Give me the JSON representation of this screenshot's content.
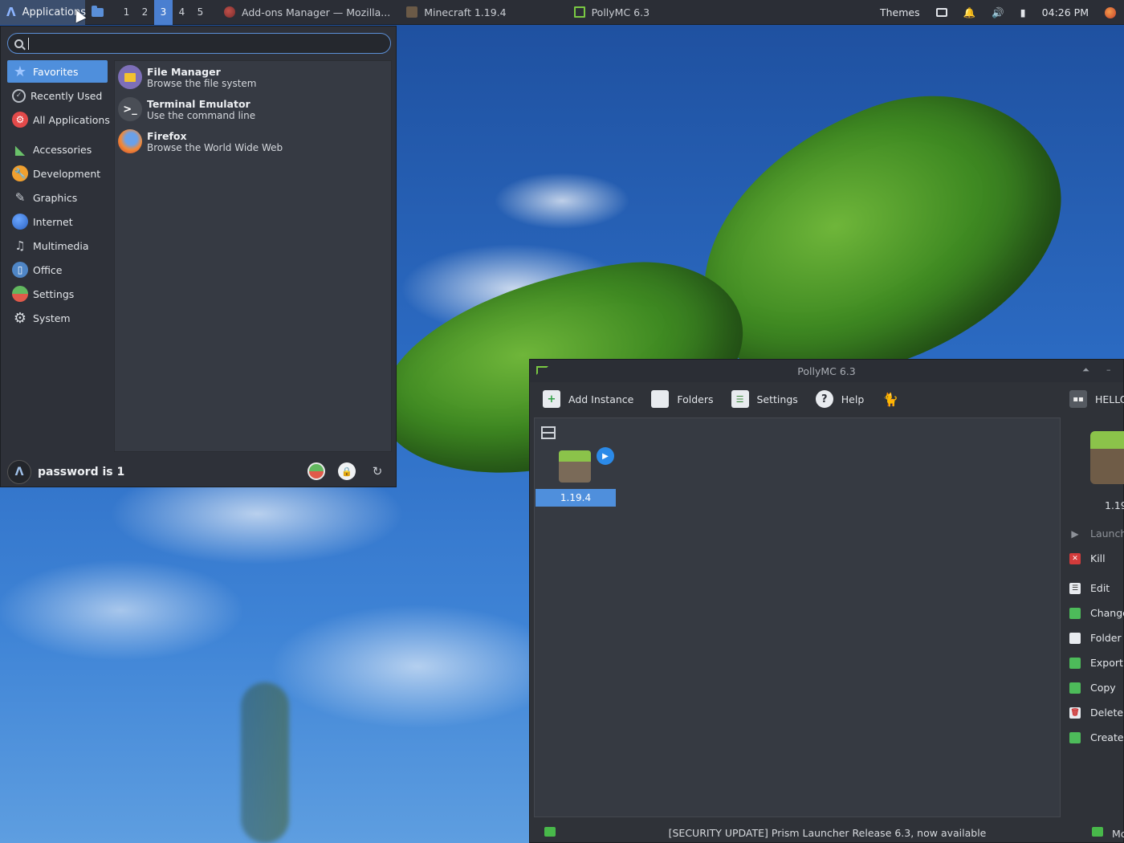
{
  "panel": {
    "applications_label": "Applications",
    "workspaces": [
      "1",
      "2",
      "3",
      "4",
      "5"
    ],
    "active_workspace": "3",
    "tasks": [
      {
        "title": "Add-ons Manager — Mozilla...",
        "icon": "firefox-icon"
      },
      {
        "title": "Minecraft 1.19.4",
        "icon": "minecraft-icon"
      },
      {
        "title": "PollyMC 6.3",
        "icon": "pollymc-icon"
      }
    ],
    "themes_label": "Themes",
    "clock": "04:26 PM"
  },
  "menu": {
    "search_value": "",
    "categories": [
      {
        "label": "Favorites",
        "icon": "star-icon",
        "color": "#4f8fdc"
      },
      {
        "label": "Recently Used",
        "icon": "clock-icon",
        "color": "#2e3139"
      },
      {
        "label": "All Applications",
        "icon": "apps-icon",
        "color": "#e34a4a"
      },
      {
        "label": "Accessories",
        "icon": "ruler-icon",
        "color": "#6ac16a"
      },
      {
        "label": "Development",
        "icon": "wrench-icon",
        "color": "#f0a030"
      },
      {
        "label": "Graphics",
        "icon": "brush-icon",
        "color": "#8a8e96"
      },
      {
        "label": "Internet",
        "icon": "globe-icon",
        "color": "#3b7ddd"
      },
      {
        "label": "Multimedia",
        "icon": "film-icon",
        "color": "#8a8e96"
      },
      {
        "label": "Office",
        "icon": "document-icon",
        "color": "#4f86c6"
      },
      {
        "label": "Settings",
        "icon": "toggle-icon",
        "color": "#62b85f"
      },
      {
        "label": "System",
        "icon": "gear-icon",
        "color": "#9aa0a8"
      }
    ],
    "apps": [
      {
        "name": "File Manager",
        "desc": "Browse the file system",
        "icon": "folder-icon",
        "color": "#7d6fb8"
      },
      {
        "name": "Terminal Emulator",
        "desc": "Use the command line",
        "icon": "terminal-icon",
        "color": "#4a4e56"
      },
      {
        "name": "Firefox",
        "desc": "Browse the World Wide Web",
        "icon": "firefox-icon",
        "color": "#e8723a"
      }
    ],
    "user": "password is 1"
  },
  "pollymc": {
    "title": "PollyMC 6.3",
    "toolbar": [
      "Add Instance",
      "Folders",
      "Settings",
      "Help"
    ],
    "account_label": "HELLO",
    "instance_name": "1.19.4",
    "side_version": "1.19",
    "side_actions": [
      {
        "label": "Launch",
        "icon": "play-icon",
        "color": "#6a6e75",
        "disabled": true
      },
      {
        "label": "Kill",
        "icon": "kill-icon",
        "color": "#d33b3b",
        "disabled": false
      },
      {
        "label": "Edit",
        "icon": "edit-icon",
        "color": "#e8ebef",
        "disabled": false
      },
      {
        "label": "Change",
        "icon": "change-icon",
        "color": "#4dbb5a",
        "disabled": false
      },
      {
        "label": "Folder",
        "icon": "folder-icon",
        "color": "#e8ebef",
        "disabled": false
      },
      {
        "label": "Export",
        "icon": "export-icon",
        "color": "#4dbb5a",
        "disabled": false
      },
      {
        "label": "Copy",
        "icon": "copy-icon",
        "color": "#4dbb5a",
        "disabled": false
      },
      {
        "label": "Delete",
        "icon": "trash-icon",
        "color": "#e8ebef",
        "disabled": false
      },
      {
        "label": "Create",
        "icon": "shortcut-icon",
        "color": "#4dbb5a",
        "disabled": false
      }
    ],
    "status_message": "[SECURITY UPDATE] Prism Launcher Release 6.3, now available",
    "status_right": "Mc"
  }
}
